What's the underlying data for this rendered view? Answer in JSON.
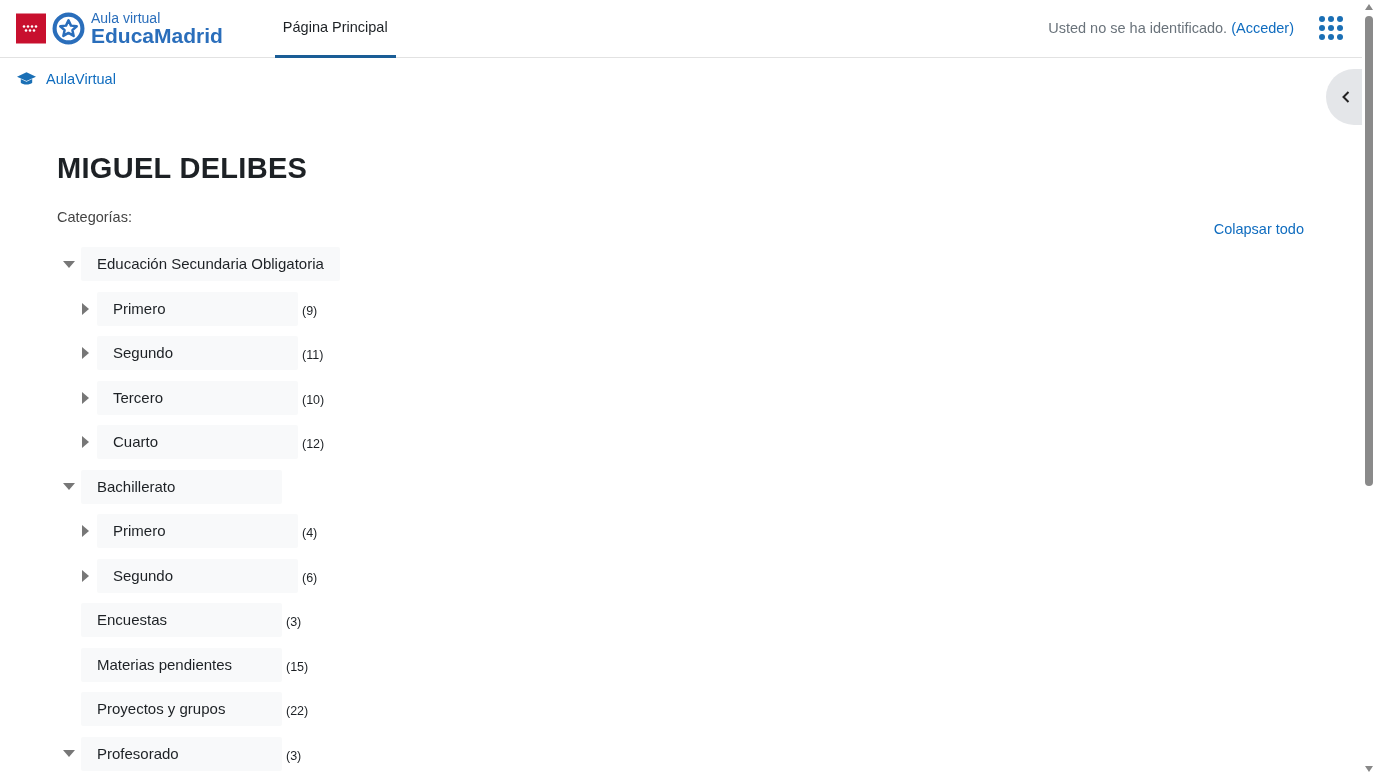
{
  "header": {
    "logo_small": "Aula virtual",
    "logo_big": "EducaMadrid",
    "nav": [
      {
        "label": "Página Principal",
        "selected": true
      }
    ],
    "login_text": "Usted no se ha identificado.",
    "login_link": "(Acceder)"
  },
  "breadcrumb": "AulaVirtual",
  "title": "MIGUEL DELIBES",
  "categories_label": "Categorías:",
  "collapse_all": "Colapsar todo",
  "categories": [
    {
      "name": "Educación Secundaria Obligatoria",
      "kind": "branch",
      "expanded": true,
      "children": [
        {
          "name": "Primero",
          "count": "(9)",
          "kind": "branch",
          "expanded": false
        },
        {
          "name": "Segundo",
          "count": "(11)",
          "kind": "branch",
          "expanded": false
        },
        {
          "name": "Tercero",
          "count": "(10)",
          "kind": "branch",
          "expanded": false
        },
        {
          "name": "Cuarto",
          "count": "(12)",
          "kind": "branch",
          "expanded": false
        }
      ]
    },
    {
      "name": "Bachillerato",
      "kind": "branch",
      "expanded": true,
      "children": [
        {
          "name": "Primero",
          "count": "(4)",
          "kind": "branch",
          "expanded": false
        },
        {
          "name": "Segundo",
          "count": "(6)",
          "kind": "branch",
          "expanded": false
        }
      ]
    },
    {
      "name": "Encuestas",
      "count": "(3)",
      "kind": "leaf"
    },
    {
      "name": "Materias pendientes",
      "count": "(15)",
      "kind": "leaf"
    },
    {
      "name": "Proyectos y grupos",
      "count": "(22)",
      "kind": "leaf"
    },
    {
      "name": "Profesorado",
      "count": "(3)",
      "kind": "branch",
      "expanded": true
    }
  ]
}
